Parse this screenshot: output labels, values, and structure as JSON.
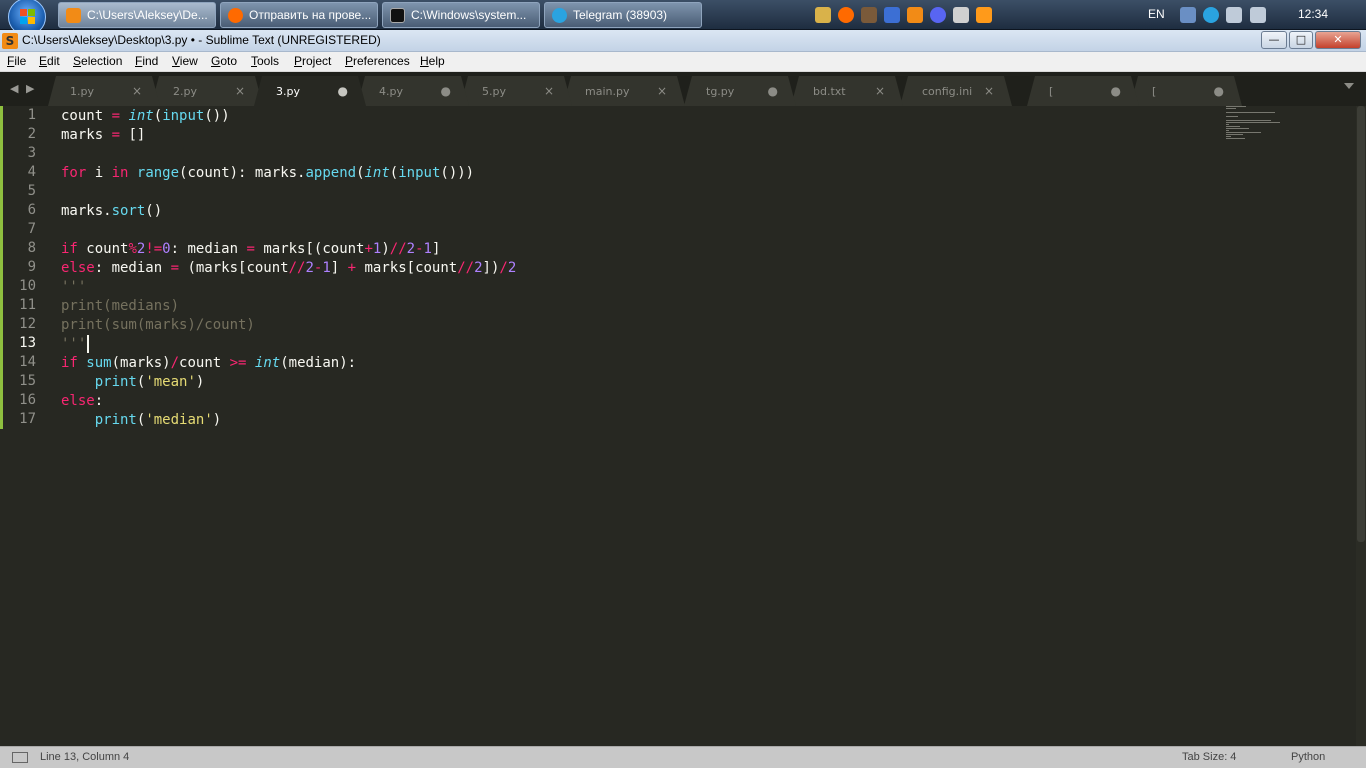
{
  "taskbar": {
    "tasks": [
      {
        "label": "C:\\Users\\Aleksey\\De...",
        "icon": "sublime-icon",
        "color": "#f28b16"
      },
      {
        "label": "Отправить на прове...",
        "icon": "firefox-icon",
        "color": "#ff6a00"
      },
      {
        "label": "C:\\Windows\\system...",
        "icon": "cmd-icon",
        "color": "#111111"
      },
      {
        "label": "Telegram (38903)",
        "icon": "telegram-icon",
        "color": "#2aa3e0"
      }
    ],
    "tray": {
      "lang": "EN",
      "clock": "12:34"
    }
  },
  "window": {
    "title": "C:\\Users\\Aleksey\\Desktop\\3.py • - Sublime Text (UNREGISTERED)",
    "minimize": "—",
    "maximize": "□",
    "close": "✕"
  },
  "menu": [
    "File",
    "Edit",
    "Selection",
    "Find",
    "View",
    "Goto",
    "Tools",
    "Project",
    "Preferences",
    "Help"
  ],
  "tabs": [
    {
      "label": "1.py",
      "state": "×"
    },
    {
      "label": "2.py",
      "state": "×"
    },
    {
      "label": "3.py",
      "state": "●"
    },
    {
      "label": "4.py",
      "state": "●"
    },
    {
      "label": "5.py",
      "state": "×"
    },
    {
      "label": "main.py",
      "state": "×"
    },
    {
      "label": "tg.py",
      "state": "●"
    },
    {
      "label": "bd.txt",
      "state": "×"
    },
    {
      "label": "config.ini",
      "state": "×"
    },
    {
      "label": "[",
      "state": "●"
    },
    {
      "label": "[",
      "state": "●"
    },
    {
      "label": "{",
      "state": "●"
    }
  ],
  "tab_nav": "◀ ▶",
  "active_tab_index": 2,
  "current_line": 13,
  "code_lines": [
    [
      [
        "id",
        "count"
      ],
      [
        "op",
        " = "
      ],
      [
        "ty",
        "int"
      ],
      [
        "id",
        "("
      ],
      [
        "fn",
        "input"
      ],
      [
        "id",
        "())"
      ]
    ],
    [
      [
        "id",
        "marks "
      ],
      [
        "op",
        "="
      ],
      [
        "id",
        " []"
      ]
    ],
    [],
    [
      [
        "kw",
        "for"
      ],
      [
        "id",
        " i "
      ],
      [
        "kw",
        "in"
      ],
      [
        "id",
        " "
      ],
      [
        "fn",
        "range"
      ],
      [
        "id",
        "(count): marks."
      ],
      [
        "fn",
        "append"
      ],
      [
        "id",
        "("
      ],
      [
        "ty",
        "int"
      ],
      [
        "id",
        "("
      ],
      [
        "fn",
        "input"
      ],
      [
        "id",
        "()))"
      ]
    ],
    [],
    [
      [
        "id",
        "marks."
      ],
      [
        "fn",
        "sort"
      ],
      [
        "id",
        "()"
      ]
    ],
    [],
    [
      [
        "kw",
        "if"
      ],
      [
        "id",
        " count"
      ],
      [
        "op",
        "%"
      ],
      [
        "nu",
        "2"
      ],
      [
        "op",
        "!="
      ],
      [
        "nu",
        "0"
      ],
      [
        "id",
        ": median "
      ],
      [
        "op",
        "="
      ],
      [
        "id",
        " marks[(count"
      ],
      [
        "op",
        "+"
      ],
      [
        "nu",
        "1"
      ],
      [
        "id",
        ")"
      ],
      [
        "op",
        "//"
      ],
      [
        "nu",
        "2"
      ],
      [
        "op",
        "-"
      ],
      [
        "nu",
        "1"
      ],
      [
        "id",
        "]"
      ]
    ],
    [
      [
        "kw",
        "else"
      ],
      [
        "id",
        ": median "
      ],
      [
        "op",
        "="
      ],
      [
        "id",
        " (marks[count"
      ],
      [
        "op",
        "//"
      ],
      [
        "nu",
        "2"
      ],
      [
        "op",
        "-"
      ],
      [
        "nu",
        "1"
      ],
      [
        "id",
        "] "
      ],
      [
        "op",
        "+"
      ],
      [
        "id",
        " marks[count"
      ],
      [
        "op",
        "//"
      ],
      [
        "nu",
        "2"
      ],
      [
        "id",
        "])"
      ],
      [
        "op",
        "/"
      ],
      [
        "nu",
        "2"
      ]
    ],
    [
      [
        "cm",
        "'''"
      ]
    ],
    [
      [
        "cm",
        "print(medians)"
      ]
    ],
    [
      [
        "cm",
        "print(sum(marks)/count)"
      ]
    ],
    [
      [
        "cm",
        "'''"
      ]
    ],
    [
      [
        "kw",
        "if"
      ],
      [
        "id",
        " "
      ],
      [
        "fn",
        "sum"
      ],
      [
        "id",
        "(marks)"
      ],
      [
        "op",
        "/"
      ],
      [
        "id",
        "count "
      ],
      [
        "op",
        ">="
      ],
      [
        "id",
        " "
      ],
      [
        "ty",
        "int"
      ],
      [
        "id",
        "(median):"
      ]
    ],
    [
      [
        "id",
        "    "
      ],
      [
        "fn",
        "print"
      ],
      [
        "id",
        "("
      ],
      [
        "st",
        "'mean'"
      ],
      [
        "id",
        ")"
      ]
    ],
    [
      [
        "kw",
        "else"
      ],
      [
        "id",
        ":"
      ]
    ],
    [
      [
        "id",
        "    "
      ],
      [
        "fn",
        "print"
      ],
      [
        "id",
        "("
      ],
      [
        "st",
        "'median'"
      ],
      [
        "id",
        ")"
      ]
    ]
  ],
  "status": {
    "position": "Line 13, Column 4",
    "tab_size": "Tab Size: 4",
    "syntax": "Python"
  },
  "colors": {
    "editor_bg": "#272822",
    "keyword": "#f92672",
    "function": "#66d9ef",
    "number": "#ae81ff",
    "string": "#e6db74",
    "comment": "#75715e",
    "modified_marker": "#8ebf3f"
  }
}
